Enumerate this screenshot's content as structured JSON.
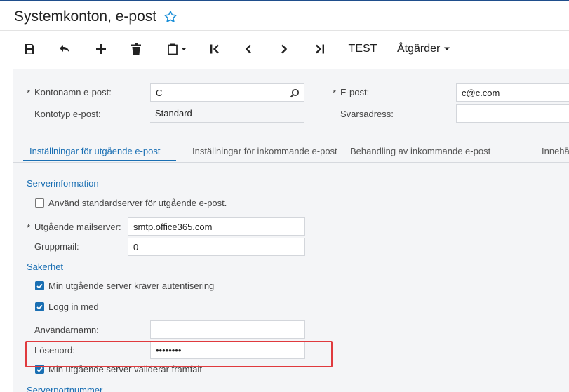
{
  "title": "Systemkonton, e-post",
  "toolbar": {
    "test_label": "TEST",
    "actions_label": "Åtgärder"
  },
  "header_fields": {
    "account_name_label": "Kontonamn e-post:",
    "account_name_value": "C",
    "account_type_label": "Kontotyp e-post:",
    "account_type_value": "Standard",
    "email_label": "E-post:",
    "email_value": "c@c.com",
    "reply_label": "Svarsadress:",
    "reply_value": ""
  },
  "tabs": [
    {
      "label": "Inställningar för utgående e-post"
    },
    {
      "label": "Inställningar för inkommande e-post"
    },
    {
      "label": "Behandling av inkommande e-post"
    },
    {
      "label": "Innehå"
    }
  ],
  "outgoing": {
    "server_info_heading": "Serverinformation",
    "use_default_server_label": "Använd standardserver för utgående e-post.",
    "use_default_server_checked": false,
    "mail_server_label": "Utgående mailserver:",
    "mail_server_value": "smtp.office365.com",
    "group_mail_label": "Gruppmail:",
    "group_mail_value": "0",
    "security_heading": "Säkerhet",
    "requires_auth_label": "Min utgående server kräver autentisering",
    "requires_auth_checked": true,
    "login_label": "Logg in med",
    "login_checked": true,
    "username_label": "Användarnamn:",
    "username_value": "",
    "password_label": "Lösenord:",
    "password_value": "••••••••",
    "validates_label": "Min utgående server validerar främfält",
    "validates_checked": true,
    "server_port_heading": "Serverportnummer"
  },
  "colors": {
    "accent": "#1a6fb3",
    "highlight": "#e03a3e"
  }
}
